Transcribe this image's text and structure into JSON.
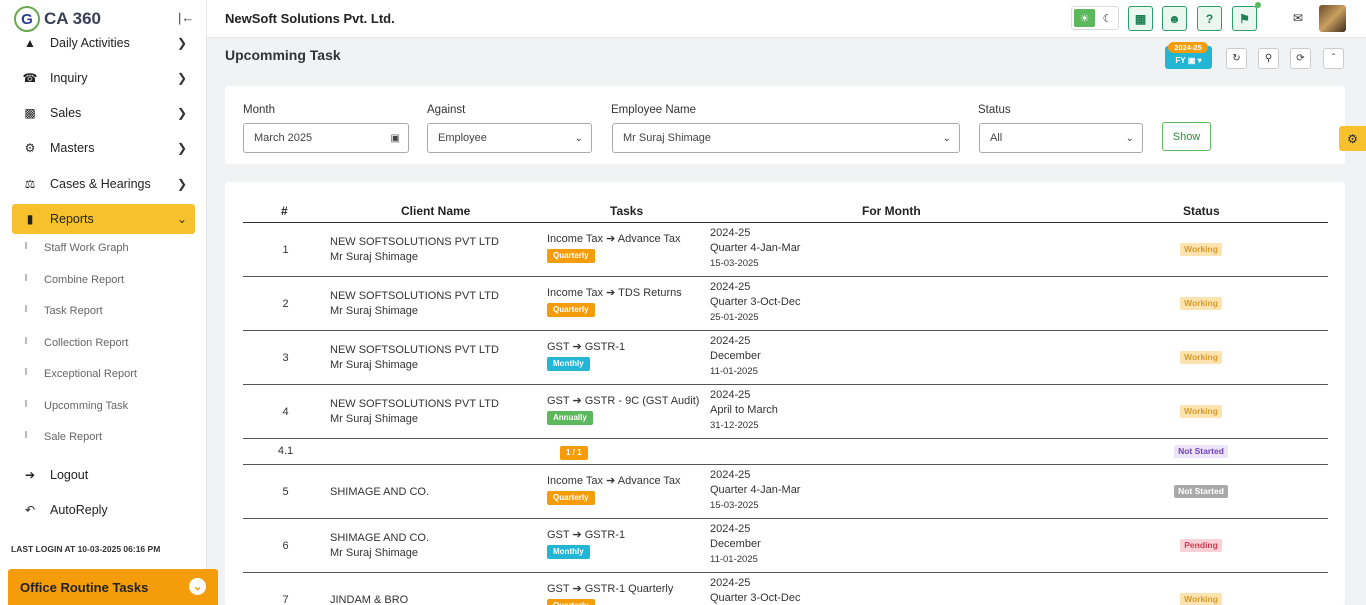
{
  "app": {
    "logo_text": "CA 360",
    "logo_mark": "G",
    "company": "NewSoft Solutions Pvt. Ltd."
  },
  "sidebar": {
    "items": [
      {
        "label": "Daily Activities",
        "icon": "pin-icon"
      },
      {
        "label": "Inquiry",
        "icon": "phone-icon"
      },
      {
        "label": "Sales",
        "icon": "money-icon"
      },
      {
        "label": "Masters",
        "icon": "gears-icon"
      },
      {
        "label": "Cases & Hearings",
        "icon": "scale-icon"
      },
      {
        "label": "Reports",
        "icon": "report-icon",
        "active": true
      }
    ],
    "sub_items": [
      "Staff Work Graph",
      "Combine Report",
      "Task Report",
      "Collection Report",
      "Exceptional Report",
      "Upcomming Task",
      "Sale Report"
    ],
    "bottom_items": [
      {
        "label": "Logout",
        "icon": "logout-icon"
      },
      {
        "label": "AutoReply",
        "icon": "reply-icon"
      }
    ],
    "last_login": "LAST LOGIN AT 10-03-2025 06:16 PM",
    "office_tasks": "Office Routine Tasks"
  },
  "header": {
    "page_title": "Upcomming Task",
    "fy_year": "2024-25",
    "fy_label": "FY"
  },
  "filters": {
    "month_label": "Month",
    "month_value": "March 2025",
    "against_label": "Against",
    "against_value": "Employee",
    "employee_label": "Employee Name",
    "employee_value": "Mr Suraj Shimage",
    "status_label": "Status",
    "status_value": "All",
    "show_label": "Show"
  },
  "table": {
    "headers": [
      "#",
      "Client Name",
      "Tasks",
      "For Month",
      "Status"
    ],
    "rows": [
      {
        "num": "1",
        "client1": "NEW SOFTSOLUTIONS PVT LTD",
        "client2": "Mr Suraj Shimage",
        "task": "Income Tax ➔ Advance Tax",
        "tag": "Quarterly",
        "tag_color": "#f59c0b",
        "m1": "2024-25",
        "m2": "Quarter 4-Jan-Mar",
        "m3": "15-03-2025",
        "status": "Working",
        "status_bg": "#fde3b0",
        "status_fg": "#d89a2a"
      },
      {
        "num": "2",
        "client1": "NEW SOFTSOLUTIONS PVT LTD",
        "client2": "Mr Suraj Shimage",
        "task": "Income Tax ➔ TDS Returns",
        "tag": "Quarterly",
        "tag_color": "#f59c0b",
        "m1": "2024-25",
        "m2": "Quarter 3-Oct-Dec",
        "m3": "25-01-2025",
        "status": "Working",
        "status_bg": "#fde3b0",
        "status_fg": "#d89a2a"
      },
      {
        "num": "3",
        "client1": "NEW SOFTSOLUTIONS PVT LTD",
        "client2": "Mr Suraj Shimage",
        "task": "GST ➔ GSTR-1",
        "tag": "Monthly",
        "tag_color": "#22b5d4",
        "m1": "2024-25",
        "m2": "December",
        "m3": "11-01-2025",
        "status": "Working",
        "status_bg": "#fde3b0",
        "status_fg": "#d89a2a"
      },
      {
        "num": "4",
        "client1": "NEW SOFTSOLUTIONS PVT LTD",
        "client2": "Mr Suraj Shimage",
        "task": "GST ➔ GSTR - 9C (GST Audit)",
        "tag": "Annually",
        "tag_color": "#5cb85c",
        "m1": "2024-25",
        "m2": "April to March",
        "m3": "31-12-2025",
        "status": "Working",
        "status_bg": "#fde3b0",
        "status_fg": "#d89a2a"
      },
      {
        "num": "4.1",
        "client1": "",
        "client2": "",
        "task": "",
        "tag": "1 / 1",
        "tag_color": "#f59c0b",
        "m1": "",
        "m2": "",
        "m3": "",
        "status": "Not Started",
        "status_bg": "#ede4f7",
        "status_fg": "#6f42c1"
      },
      {
        "num": "5",
        "client1": "SHIMAGE AND CO.",
        "client2": "",
        "task": "Income Tax ➔ Advance Tax",
        "tag": "Quarterly",
        "tag_color": "#f59c0b",
        "m1": "2024-25",
        "m2": "Quarter 4-Jan-Mar",
        "m3": "15-03-2025",
        "status": "Not Started",
        "status_bg": "#a9a9a9",
        "status_fg": "#ffffff"
      },
      {
        "num": "6",
        "client1": "SHIMAGE AND CO.",
        "client2": "Mr Suraj Shimage",
        "task": "GST ➔ GSTR-1",
        "tag": "Monthly",
        "tag_color": "#22b5d4",
        "m1": "2024-25",
        "m2": "December",
        "m3": "11-01-2025",
        "status": "Pending",
        "status_bg": "#fbd0d6",
        "status_fg": "#d33a52"
      },
      {
        "num": "7",
        "client1": "JINDAM & BRO",
        "client2": "",
        "task": "GST ➔ GSTR-1 Quarterly",
        "tag": "Quarterly",
        "tag_color": "#f59c0b",
        "m1": "2024-25",
        "m2": "Quarter 3-Oct-Dec",
        "m3": "",
        "status": "Working",
        "status_bg": "#fde3b0",
        "status_fg": "#d89a2a"
      }
    ]
  }
}
